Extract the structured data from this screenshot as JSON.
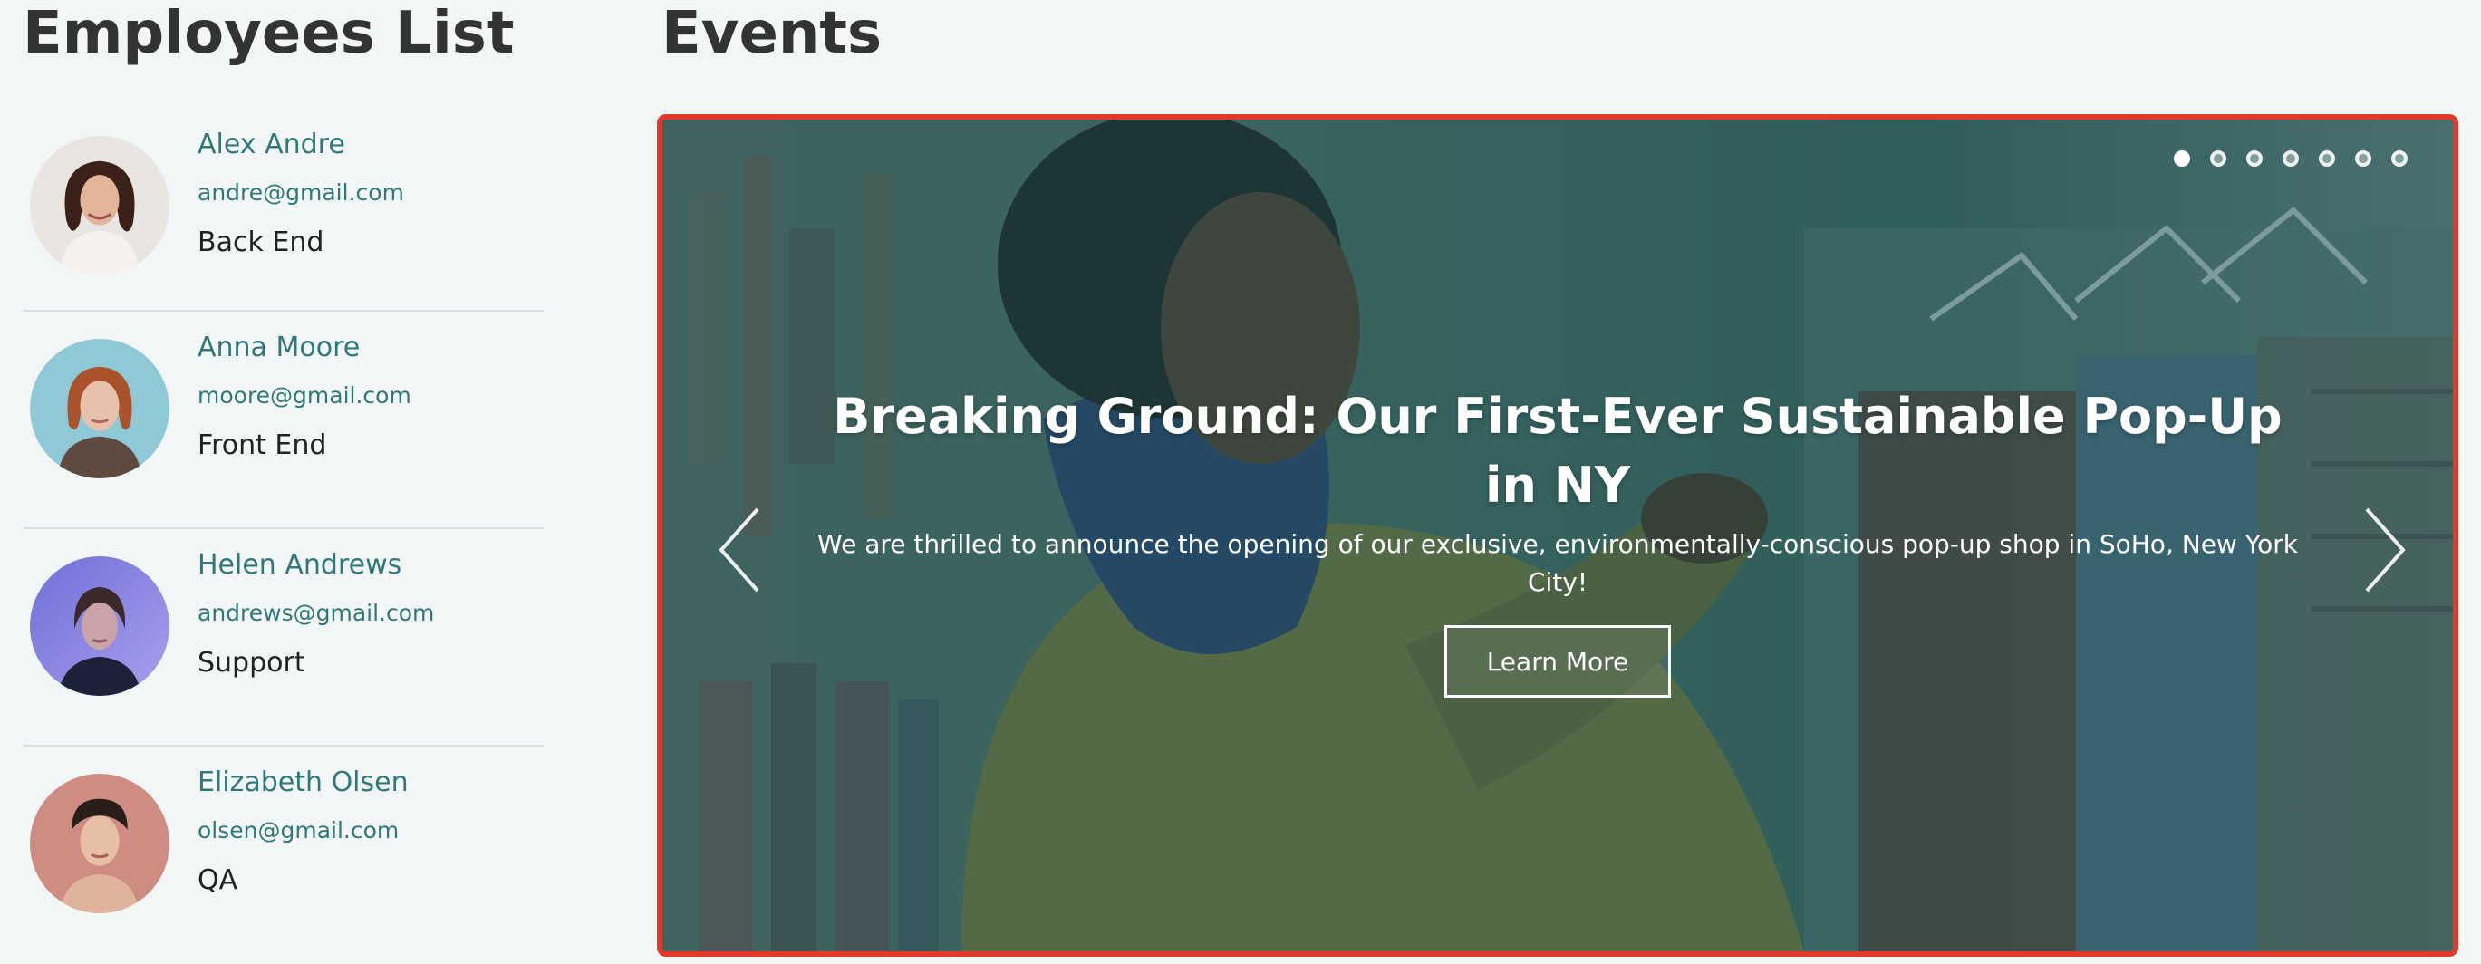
{
  "employees": {
    "title": "Employees List",
    "items": [
      {
        "name": "Alex Andre",
        "email": "andre@gmail.com",
        "role": "Back End"
      },
      {
        "name": "Anna Moore",
        "email": "moore@gmail.com",
        "role": "Front End"
      },
      {
        "name": "Helen Andrews",
        "email": "andrews@gmail.com",
        "role": "Support"
      },
      {
        "name": "Elizabeth Olsen",
        "email": "olsen@gmail.com",
        "role": "QA"
      }
    ]
  },
  "events": {
    "title": "Events",
    "carousel": {
      "slide_title": "Breaking Ground: Our First-Ever Sustainable Pop-Up in NY",
      "slide_text": "We are thrilled to announce the opening of our exclusive, environmentally-conscious pop-up shop in SoHo, New York City!",
      "button_label": "Learn More",
      "indicator_count": 7,
      "active_indicator": 1
    }
  },
  "colors": {
    "accent_teal": "#2f7a78",
    "highlight_border": "#e03b2a",
    "heading": "#333333"
  }
}
